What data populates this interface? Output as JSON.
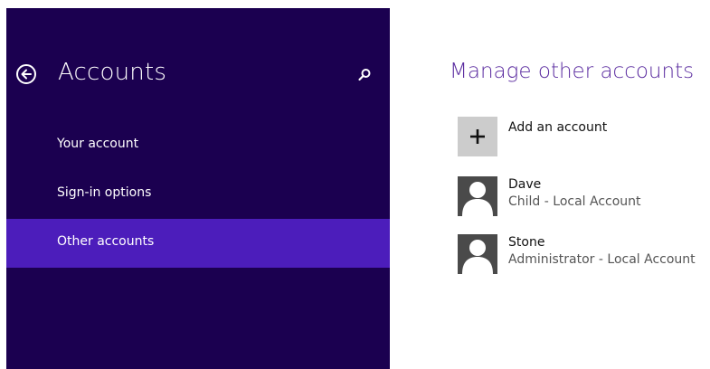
{
  "colors": {
    "pane_background": "#1b0050",
    "selected_item": "#4c1dbb",
    "title_accent": "#5b2ca0",
    "tile_gray": "#cccccc",
    "avatar_gray": "#4a4a4a"
  },
  "left_pane": {
    "title": "Accounts",
    "back_icon": "back-arrow-circle-icon",
    "search_icon": "search-icon",
    "nav_items": [
      {
        "label": "Your account",
        "selected": false
      },
      {
        "label": "Sign-in options",
        "selected": false
      },
      {
        "label": "Other accounts",
        "selected": true
      }
    ]
  },
  "main": {
    "title": "Manage other accounts",
    "add_account": {
      "label": "Add an account",
      "icon": "plus-icon"
    },
    "accounts": [
      {
        "name": "Dave",
        "type": "Child - Local Account",
        "avatar_icon": "user-silhouette-icon"
      },
      {
        "name": "Stone",
        "type": "Administrator - Local Account",
        "avatar_icon": "user-silhouette-icon"
      }
    ]
  }
}
